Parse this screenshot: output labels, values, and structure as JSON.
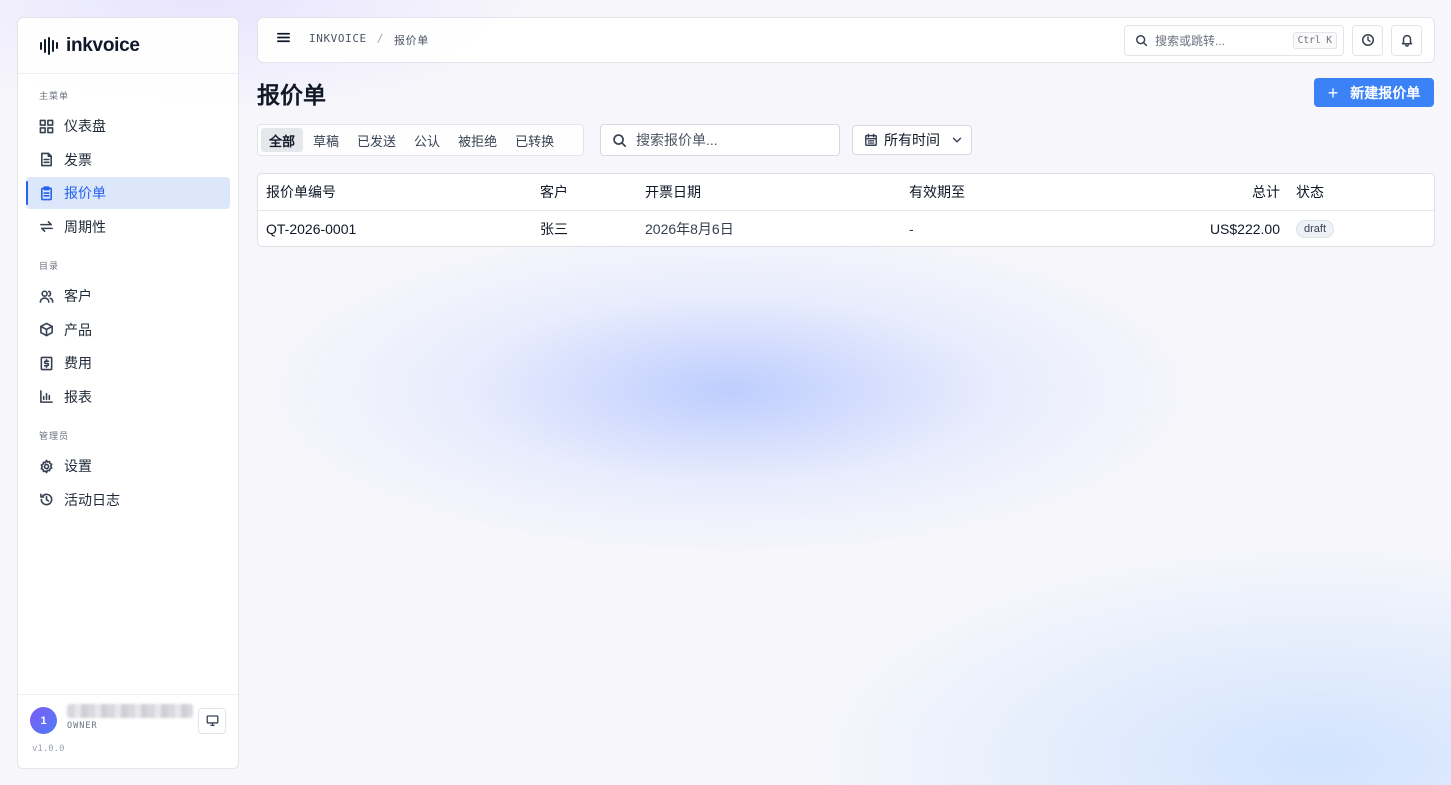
{
  "sidebar": {
    "brand": "inkvoice",
    "sections": [
      {
        "title": "主菜单",
        "items": [
          {
            "label": "仪表盘",
            "icon": "dashboard-icon"
          },
          {
            "label": "发票",
            "icon": "invoice-icon"
          },
          {
            "label": "报价单",
            "icon": "quote-icon",
            "active": true
          },
          {
            "label": "周期性",
            "icon": "recurring-icon"
          }
        ]
      },
      {
        "title": "目录",
        "items": [
          {
            "label": "客户",
            "icon": "users-icon"
          },
          {
            "label": "产品",
            "icon": "package-icon"
          },
          {
            "label": "费用",
            "icon": "expense-icon"
          },
          {
            "label": "报表",
            "icon": "chart-icon"
          }
        ]
      },
      {
        "title": "管理员",
        "items": [
          {
            "label": "设置",
            "icon": "settings-icon"
          },
          {
            "label": "活动日志",
            "icon": "history-icon"
          }
        ]
      }
    ],
    "user": {
      "initial": "1",
      "role": "OWNER"
    },
    "version": "v1.0.0"
  },
  "topbar": {
    "breadcrumb": [
      "INKVOICE",
      "报价单"
    ],
    "breadcrumb_separator": "/",
    "search_placeholder": "搜索或跳转...",
    "search_shortcut": "Ctrl K"
  },
  "main": {
    "title": "报价单",
    "new_button": "新建报价单",
    "tabs": [
      "全部",
      "草稿",
      "已发送",
      "公认",
      "被拒绝",
      "已转换"
    ],
    "active_tab": 0,
    "search_placeholder": "搜索报价单...",
    "date_filter": "所有时间",
    "table": {
      "columns": [
        "报价单编号",
        "客户",
        "开票日期",
        "有效期至",
        "总计",
        "状态"
      ],
      "rows": [
        {
          "number": "QT-2026-0001",
          "client": "张三",
          "date": "2026年8月6日",
          "valid_until": "-",
          "total": "US$222.00",
          "status": "draft"
        }
      ]
    }
  },
  "colors": {
    "accent": "#3b82f6",
    "active_bg": "#dde7fb",
    "active_text": "#2563eb"
  }
}
